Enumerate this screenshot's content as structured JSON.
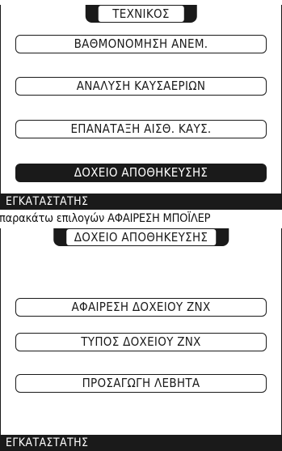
{
  "screen1": {
    "title": "ΤΕΧΝΙΚΟΣ",
    "items": [
      {
        "label": "ΒΑΘΜΟΝΟΜΗΣΗ ΑΝΕΜ."
      },
      {
        "label": "ΑΝΑΛΥΣΗ ΚΑΥΣΑΕΡΙΩΝ"
      },
      {
        "label": "ΕΠΑΝΑΤΑΞΗ ΑΙΣΘ. ΚΑΥΣ."
      },
      {
        "label": "ΔΟΧΕΙΟ ΑΠΟΘΗΚΕΥΣΗΣ"
      }
    ],
    "footer": "ΕΓΚΑΤΑΣΤΑΤΗΣ"
  },
  "caption": "ν παρακάτω επιλογών ΑΦΑΙΡΕΣΗ ΜΠΟΪΛΕΡ",
  "screen2": {
    "title": "ΔΟΧΕΙΟ ΑΠΟΘΗΚΕΥΣΗΣ",
    "items": [
      {
        "label": "ΑΦΑΙΡΕΣΗ ΔΟΧΕΙΟΥ ΖΝΧ"
      },
      {
        "label": "ΤΥΠΟΣ ΔΟΧΕΙΟΥ ΖΝΧ"
      },
      {
        "label": "ΠΡΟΣΑΓΩΓΗ ΛΕΒΗΤΑ"
      }
    ],
    "footer": "ΕΓΚΑΤΑΣΤΑΤΗΣ"
  },
  "colors": {
    "foreground": "#1a1a1a",
    "background": "#ffffff"
  }
}
